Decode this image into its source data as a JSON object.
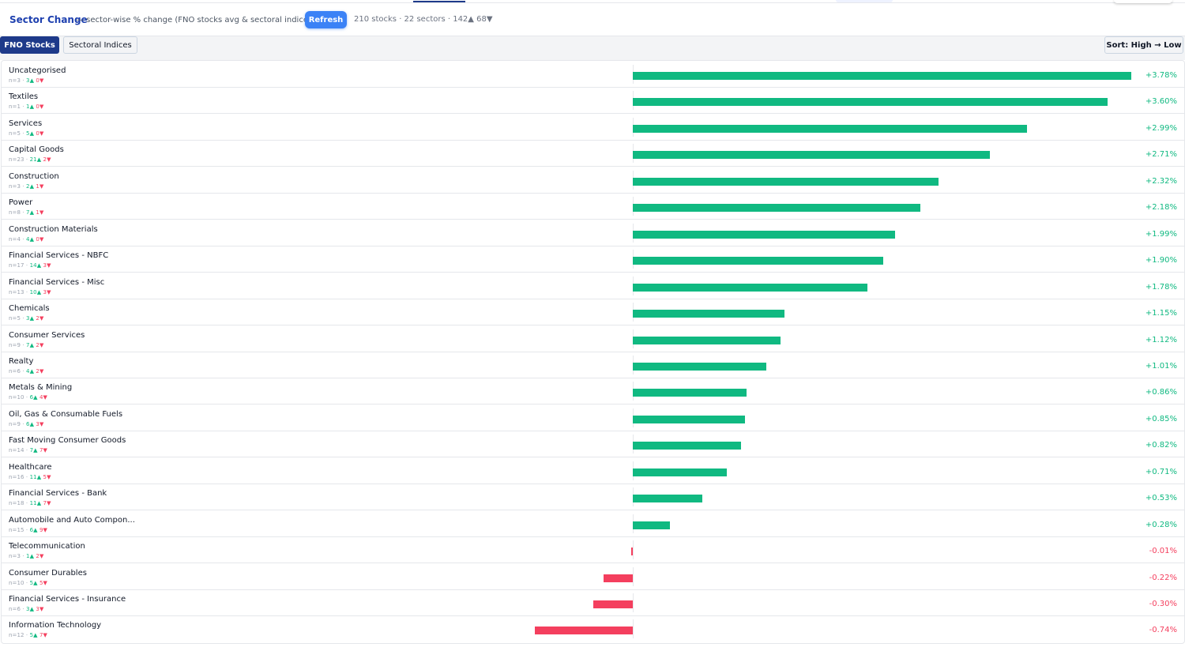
{
  "header": {
    "title": "Sector Change",
    "subtitle": "— sector-wise % change (FNO stocks avg & sectoral indices)",
    "refresh_label": "Refresh",
    "stats": "210 stocks · 22 sectors · 142▲ 68▼"
  },
  "toolbar": {
    "tab_fno": "FNO Stocks",
    "tab_sectoral": "Sectoral Indices",
    "active_tab": "FNO Stocks",
    "sort_label": "Sort: High → Low"
  },
  "colors": {
    "accent": "#1e3a8a",
    "positive": "#10b981",
    "negative": "#f43f5e",
    "button": "#3b82f6"
  },
  "scale_max_pct": 3.78,
  "sectors": [
    {
      "name": "Uncategorised",
      "meta_n": "n=3 · ",
      "up": "3▲",
      "down": "0▼",
      "pct_label": "+3.78%",
      "value": 3.78
    },
    {
      "name": "Textiles",
      "meta_n": "n=1 · ",
      "up": "1▲",
      "down": "0▼",
      "pct_label": "+3.60%",
      "value": 3.6
    },
    {
      "name": "Services",
      "meta_n": "n=5 · ",
      "up": "5▲",
      "down": "0▼",
      "pct_label": "+2.99%",
      "value": 2.99
    },
    {
      "name": "Capital Goods",
      "meta_n": "n=23 · ",
      "up": "21▲",
      "down": "2▼",
      "pct_label": "+2.71%",
      "value": 2.71
    },
    {
      "name": "Construction",
      "meta_n": "n=3 · ",
      "up": "2▲",
      "down": "1▼",
      "pct_label": "+2.32%",
      "value": 2.32
    },
    {
      "name": "Power",
      "meta_n": "n=8 · ",
      "up": "7▲",
      "down": "1▼",
      "pct_label": "+2.18%",
      "value": 2.18
    },
    {
      "name": "Construction Materials",
      "meta_n": "n=4 · ",
      "up": "4▲",
      "down": "0▼",
      "pct_label": "+1.99%",
      "value": 1.99
    },
    {
      "name": "Financial Services - NBFC",
      "meta_n": "n=17 · ",
      "up": "14▲",
      "down": "3▼",
      "pct_label": "+1.90%",
      "value": 1.9
    },
    {
      "name": "Financial Services - Misc",
      "meta_n": "n=13 · ",
      "up": "10▲",
      "down": "3▼",
      "pct_label": "+1.78%",
      "value": 1.78
    },
    {
      "name": "Chemicals",
      "meta_n": "n=5 · ",
      "up": "3▲",
      "down": "2▼",
      "pct_label": "+1.15%",
      "value": 1.15
    },
    {
      "name": "Consumer Services",
      "meta_n": "n=9 · ",
      "up": "7▲",
      "down": "2▼",
      "pct_label": "+1.12%",
      "value": 1.12
    },
    {
      "name": "Realty",
      "meta_n": "n=6 · ",
      "up": "4▲",
      "down": "2▼",
      "pct_label": "+1.01%",
      "value": 1.01
    },
    {
      "name": "Metals & Mining",
      "meta_n": "n=10 · ",
      "up": "6▲",
      "down": "4▼",
      "pct_label": "+0.86%",
      "value": 0.86
    },
    {
      "name": "Oil, Gas & Consumable Fuels",
      "meta_n": "n=9 · ",
      "up": "6▲",
      "down": "3▼",
      "pct_label": "+0.85%",
      "value": 0.85
    },
    {
      "name": "Fast Moving Consumer Goods",
      "meta_n": "n=14 · ",
      "up": "7▲",
      "down": "7▼",
      "pct_label": "+0.82%",
      "value": 0.82
    },
    {
      "name": "Healthcare",
      "meta_n": "n=16 · ",
      "up": "11▲",
      "down": "5▼",
      "pct_label": "+0.71%",
      "value": 0.71
    },
    {
      "name": "Financial Services - Bank",
      "meta_n": "n=18 · ",
      "up": "11▲",
      "down": "7▼",
      "pct_label": "+0.53%",
      "value": 0.53
    },
    {
      "name": "Automobile and Auto Compon...",
      "meta_n": "n=15 · ",
      "up": "6▲",
      "down": "9▼",
      "pct_label": "+0.28%",
      "value": 0.28
    },
    {
      "name": "Telecommunication",
      "meta_n": "n=3 · ",
      "up": "1▲",
      "down": "2▼",
      "pct_label": "-0.01%",
      "value": -0.01
    },
    {
      "name": "Consumer Durables",
      "meta_n": "n=10 · ",
      "up": "5▲",
      "down": "5▼",
      "pct_label": "-0.22%",
      "value": -0.22
    },
    {
      "name": "Financial Services - Insurance",
      "meta_n": "n=6 · ",
      "up": "3▲",
      "down": "3▼",
      "pct_label": "-0.30%",
      "value": -0.3
    },
    {
      "name": "Information Technology",
      "meta_n": "n=12 · ",
      "up": "5▲",
      "down": "7▼",
      "pct_label": "-0.74%",
      "value": -0.74
    }
  ]
}
